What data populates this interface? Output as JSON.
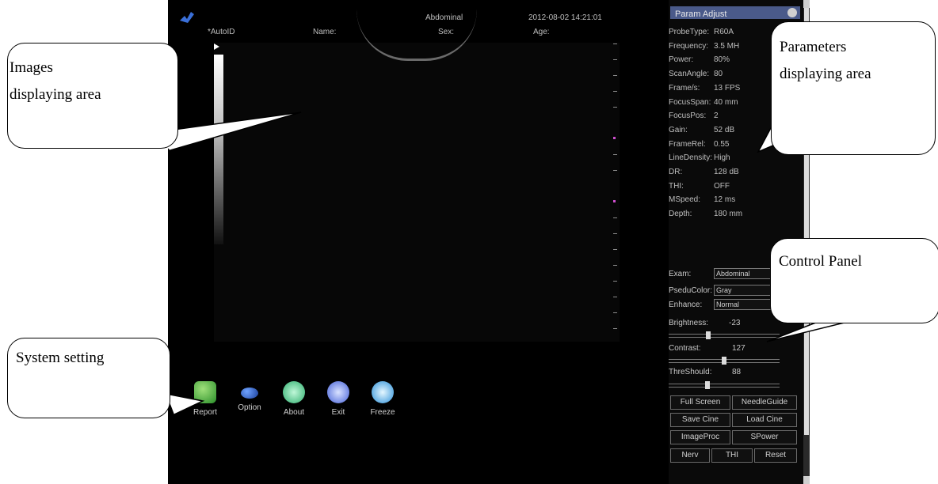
{
  "header": {
    "mode": "Abdominal",
    "datetime": "2012-08-02 14:21:01",
    "patient_fields": [
      "*AutoID",
      "Name:",
      "Sex:",
      "Age:"
    ]
  },
  "system_buttons": [
    {
      "label": "Report",
      "icon": "report-icon"
    },
    {
      "label": "Option",
      "icon": "option-icon"
    },
    {
      "label": "About",
      "icon": "about-icon"
    },
    {
      "label": "Exit",
      "icon": "exit-icon"
    },
    {
      "label": "Freeze",
      "icon": "freeze-icon"
    }
  ],
  "panel": {
    "title": "Param Adjust",
    "params": [
      {
        "k": "ProbeType:",
        "v": "R60A"
      },
      {
        "k": "Frequency:",
        "v": "3.5 MH"
      },
      {
        "k": "Power:",
        "v": "80%"
      },
      {
        "k": "ScanAngle:",
        "v": "80"
      },
      {
        "k": "Frame/s:",
        "v": "13 FPS"
      },
      {
        "k": "FocusSpan:",
        "v": "40 mm"
      },
      {
        "k": "FocusPos:",
        "v": "2"
      },
      {
        "k": "Gain:",
        "v": "52 dB"
      },
      {
        "k": "FrameRel:",
        "v": "0.55"
      },
      {
        "k": "LineDensity:",
        "v": "High"
      },
      {
        "k": "DR:",
        "v": "128 dB"
      },
      {
        "k": "THI:",
        "v": "OFF"
      },
      {
        "k": "MSpeed:",
        "v": "12 ms"
      },
      {
        "k": "Depth:",
        "v": "180 mm"
      }
    ],
    "exam": {
      "label": "Exam:",
      "value": "Abdominal"
    },
    "pseudocolor": {
      "label": "PseduColor:",
      "value": "Gray"
    },
    "enhance": {
      "label": "Enhance:",
      "value": "Normal"
    },
    "brightness": {
      "label": "Brightness:",
      "value": "-23",
      "level": 0.35
    },
    "contrast": {
      "label": "Contrast:",
      "value": "127",
      "level": 0.5
    },
    "threshold": {
      "label": "ThreShould:",
      "value": "88",
      "level": 0.34
    },
    "buttons": [
      [
        "Full Screen",
        "NeedleGuide"
      ],
      [
        "Save Cine",
        "Load Cine"
      ],
      [
        "ImageProc",
        "SPower"
      ],
      [
        "Nerv",
        "THI",
        "Reset"
      ]
    ]
  },
  "callouts": {
    "images": [
      "Images",
      "displaying area"
    ],
    "parameters": [
      "Parameters",
      "displaying area"
    ],
    "control": "Control Panel",
    "system": "System setting"
  },
  "colors": {
    "accent": "#4a5a8a",
    "screen_bg": "#000000",
    "marker": "#d04fd0"
  }
}
